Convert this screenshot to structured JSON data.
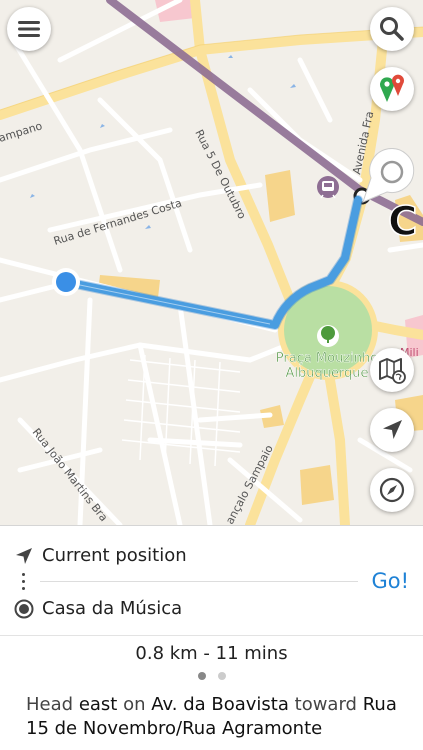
{
  "map": {
    "streets": {
      "fernandes_costa": "Rua de Fernandes Costa",
      "joao_martins": "Rua João Martins Bra",
      "cinco_outubro": "Rua 5 De Outubro",
      "avenida_fra": "Avenida Fra",
      "goncalo_sampaio": "ançalo Sampaio",
      "campano": "ampano"
    },
    "poi": {
      "park_line1": "Praça Mouzinho",
      "park_line2": "Albuquerque",
      "mili": "Mili"
    },
    "metro_letter": "C",
    "colors": {
      "route": "#4a9de0",
      "metro": "#8e6e93",
      "park": "#b9dfa3",
      "road_major": "#fbe29b",
      "road_minor": "#ffffff",
      "building": "#f6d58b"
    }
  },
  "buttons": {
    "menu": "menu-icon",
    "search": "search-icon",
    "pins": "map-pins-icon",
    "callout": "pin-callout-icon",
    "map_layers": "map-globe-icon",
    "locate": "location-arrow-icon",
    "compass": "compass-icon"
  },
  "panel": {
    "origin": "Current position",
    "destination": "Casa da Música",
    "go_label": "Go!",
    "summary": "0.8 km - 11 mins",
    "page_count": 2,
    "active_page": 1,
    "instruction": {
      "w1": "Head",
      "dir": "east",
      "w2": "on",
      "street": "Av. da Boavista",
      "w3": "toward",
      "target": "Rua 15 de Novembro/Rua Agramonte"
    },
    "accent": "#1f82d6"
  }
}
